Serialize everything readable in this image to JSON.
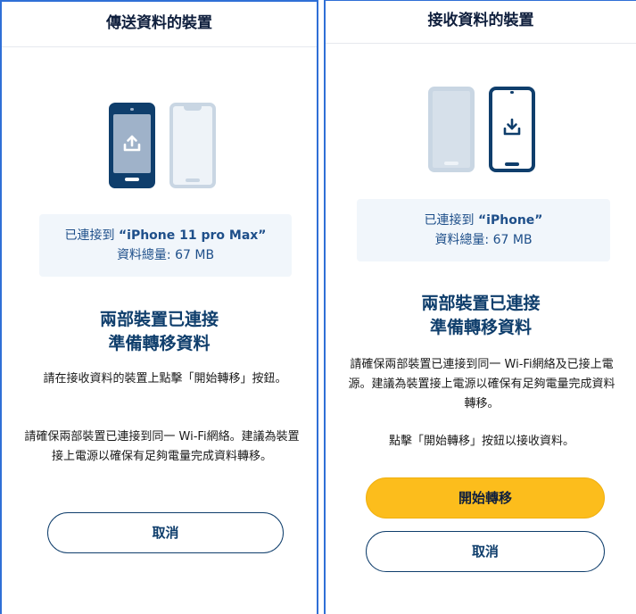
{
  "left": {
    "title": "傳送資料的裝置",
    "connected_prefix": "已連接到 ",
    "device_name": "“iPhone 11 pro Max”",
    "data_total": "資料總量: 67 MB",
    "heading_line1": "兩部裝置已連接",
    "heading_line2": "準備轉移資料",
    "instruction": "請在接收資料的裝置上點擊「開始轉移」按鈕。",
    "note": "請確保兩部裝置已連接到同一 Wi-Fi網絡。建議為裝置接上電源以確保有足夠電量完成資料轉移。",
    "cancel_label": "取消"
  },
  "right": {
    "title": "接收資料的裝置",
    "connected_prefix": "已連接到 ",
    "device_name": "“iPhone”",
    "data_total": "資料總量: 67 MB",
    "heading_line1": "兩部裝置已連接",
    "heading_line2": "準備轉移資料",
    "note": "請確保兩部裝置已連接到同一 Wi-Fi網絡及已接上電源。建議為裝置接上電源以確保有足夠電量完成資料轉移。",
    "instruction": "點擊「開始轉移」按鈕以接收資料。",
    "start_label": "開始轉移",
    "cancel_label": "取消"
  },
  "colors": {
    "accent_dark": "#0f3e6c",
    "start_button": "#fcbd1c",
    "panel_border": "#2f6fd6"
  },
  "icons": [
    "upload-icon",
    "download-icon"
  ]
}
